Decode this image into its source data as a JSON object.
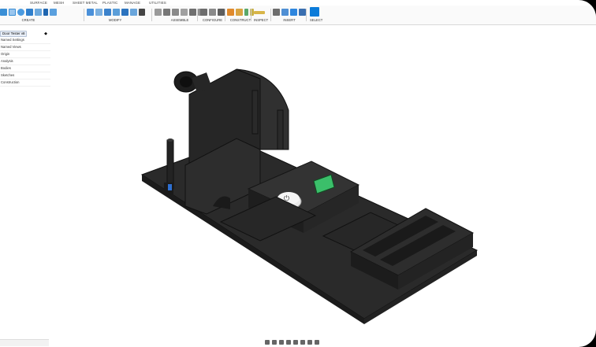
{
  "workspace_tabs": [
    "SURFACE",
    "MESH",
    "SHEET METAL",
    "PLASTIC",
    "MANAGE",
    "UTILITIES"
  ],
  "groups": {
    "create": "CREATE",
    "modify": "MODIFY",
    "assemble": "ASSEMBLE",
    "configure": "CONFIGURE",
    "construct": "CONSTRUCT",
    "inspect": "INSPECT",
    "insert": "INSERT",
    "select": "SELECT"
  },
  "browser": {
    "title": "Door Tester v8",
    "items": [
      "Named Settings",
      "Named Views",
      "Origin",
      "Analysis",
      "Bodies",
      "Sketches",
      "Construction"
    ]
  },
  "colors": {
    "accent": "#0a7bd9",
    "model": "#2b2b2b",
    "screen": "#3bbf6a"
  }
}
